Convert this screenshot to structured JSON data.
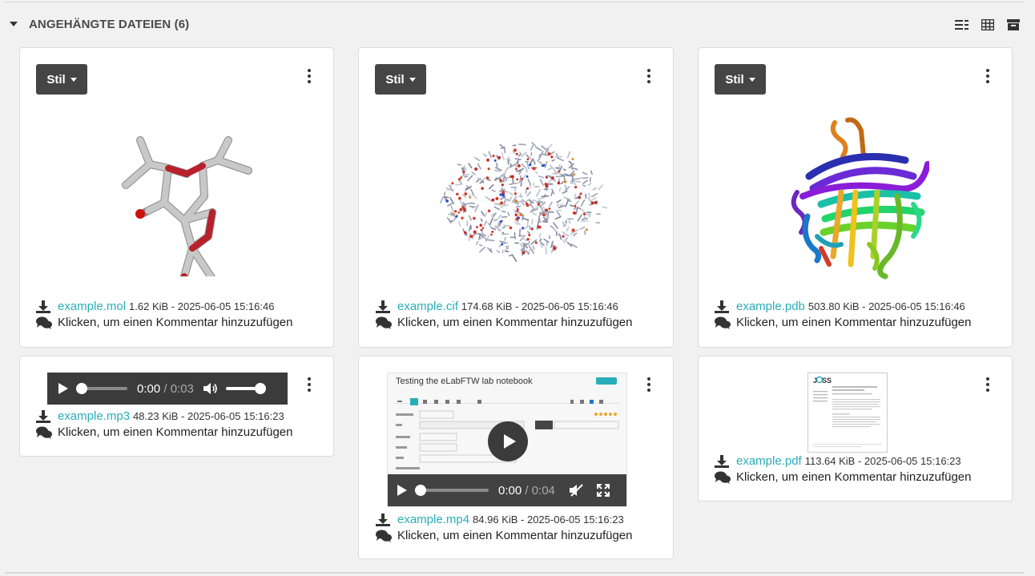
{
  "section": {
    "title": "ANGEHÄNGTE DATEIEN (6)",
    "tools": [
      {
        "icon": "list-view-icon"
      },
      {
        "icon": "grid-view-icon"
      },
      {
        "icon": "archive-icon"
      }
    ]
  },
  "attachments": [
    {
      "name": "example.mol",
      "meta": "1.62 KiB - 2025-06-05 15:16:46",
      "style_button": "Stil",
      "preview": "molecule-3d"
    },
    {
      "name": "example.cif",
      "meta": "174.68 KiB - 2025-06-05 15:16:46",
      "style_button": "Stil",
      "preview": "crystal-structure-3d"
    },
    {
      "name": "example.pdb",
      "meta": "503.80 KiB - 2025-06-05 15:16:46",
      "style_button": "Stil",
      "preview": "protein-ribbon-3d"
    },
    {
      "name": "example.mp3",
      "meta": "48.23 KiB - 2025-06-05 15:16:23",
      "preview": "audio-player",
      "player": {
        "current": "0:00",
        "duration": "/ 0:03",
        "volume": 1.0,
        "progress": 0.0
      }
    },
    {
      "name": "example.mp4",
      "meta": "84.96 KiB - 2025-06-05 15:16:23",
      "preview": "video-player",
      "player": {
        "current": "0:00",
        "duration": "/ 0:04",
        "progress": 0.0,
        "frame_title": "Testing the eLabFTW lab notebook"
      }
    },
    {
      "name": "example.pdf",
      "meta": "113.64 KiB - 2025-06-05 15:16:23",
      "preview": "pdf-thumbnail"
    }
  ],
  "comment_prompt": "Klicken, um einen Kommentar hinzuzufügen",
  "colors": {
    "link": "#29aeb9",
    "button": "#454545",
    "player": "#3b3b3b"
  }
}
